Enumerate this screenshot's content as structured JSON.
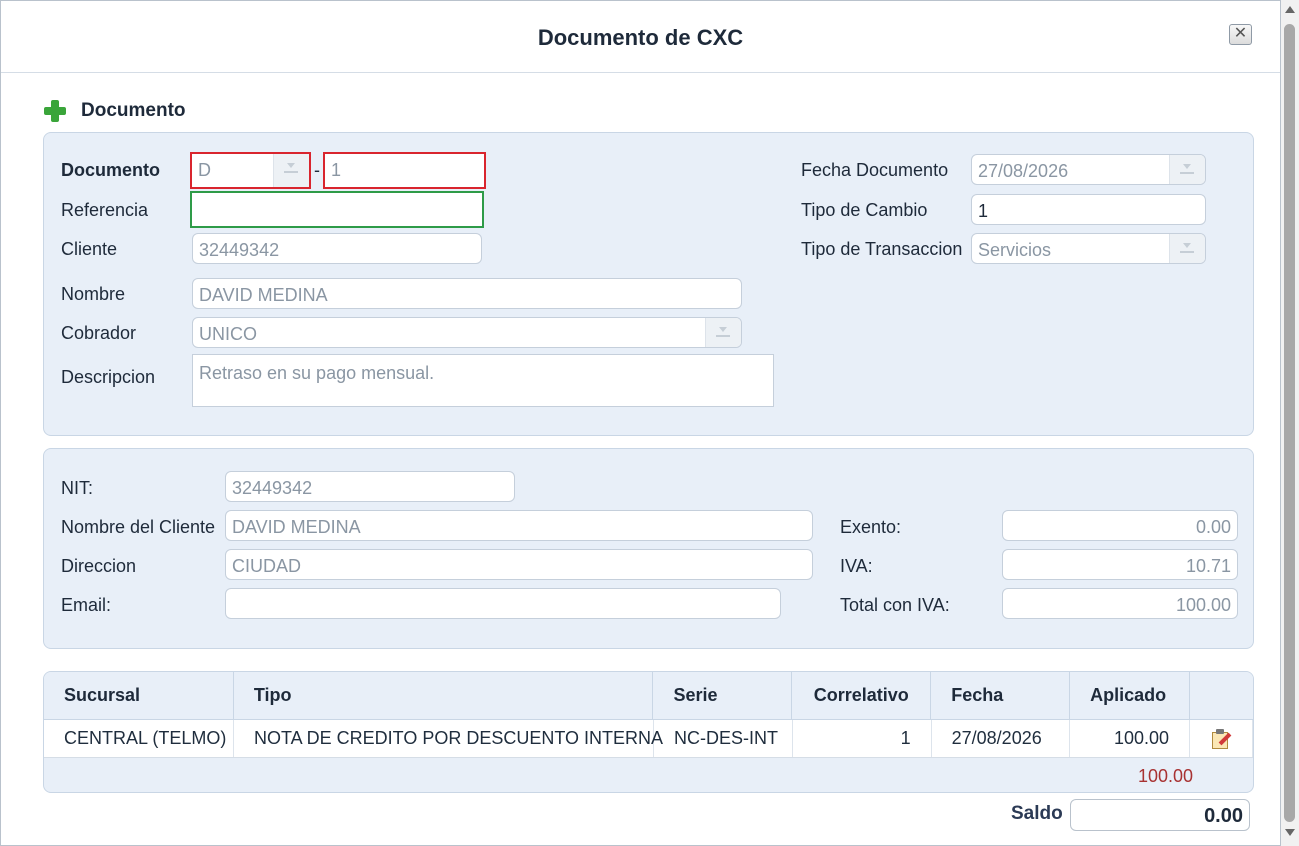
{
  "dialog": {
    "title": "Documento de CXC",
    "close_symbol": "✕"
  },
  "section": {
    "title": "Documento"
  },
  "doc": {
    "documento_label": "Documento",
    "serie_value": "D",
    "separator": "-",
    "numero_value": "1",
    "referencia_label": "Referencia",
    "referencia_value": "",
    "cliente_label": "Cliente",
    "cliente_value": "32449342",
    "nombre_label": "Nombre",
    "nombre_value": "DAVID MEDINA",
    "cobrador_label": "Cobrador",
    "cobrador_value": "UNICO",
    "descripcion_label": "Descripcion",
    "descripcion_value": "Retraso en su pago mensual.",
    "fecha_label": "Fecha Documento",
    "fecha_value": "27/08/2026",
    "tipo_cambio_label": "Tipo de Cambio",
    "tipo_cambio_value": "1",
    "tipo_transaccion_label": "Tipo de Transaccion",
    "tipo_transaccion_value": "Servicios"
  },
  "billing": {
    "nit_label": "NIT:",
    "nit_value": "32449342",
    "nombre_cliente_label": "Nombre del Cliente",
    "nombre_cliente_value": "DAVID MEDINA",
    "direccion_label": "Direccion",
    "direccion_value": "CIUDAD",
    "email_label": "Email:",
    "email_value": "",
    "exento_label": "Exento:",
    "exento_value": "0.00",
    "iva_label": "IVA:",
    "iva_value": "10.71",
    "total_label": "Total con IVA:",
    "total_value": "100.00"
  },
  "table": {
    "headers": [
      "Sucursal",
      "Tipo",
      "Serie",
      "Correlativo",
      "Fecha",
      "Aplicado"
    ],
    "rows": [
      {
        "sucursal": "CENTRAL (TELMO)",
        "tipo": "NOTA DE CREDITO POR DESCUENTO INTERNA",
        "serie": "NC-DES-INT",
        "correlativo": "1",
        "fecha": "27/08/2026",
        "aplicado": "100.00"
      }
    ],
    "total_aplicado": "100.00"
  },
  "saldo": {
    "label": "Saldo",
    "value": "0.00"
  },
  "colors": {
    "panel_bg": "#e8eff8",
    "red_outline": "#d9252e",
    "green_outline": "#2e9b48",
    "total_red": "#a83232"
  }
}
